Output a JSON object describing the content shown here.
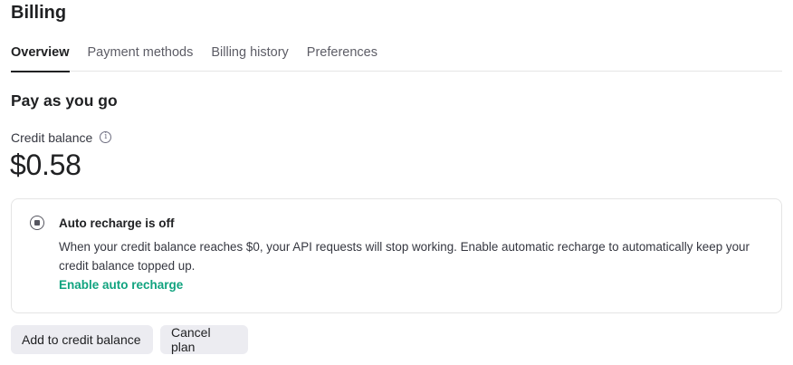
{
  "page": {
    "title": "Billing"
  },
  "tabs": [
    {
      "label": "Overview",
      "active": true
    },
    {
      "label": "Payment methods",
      "active": false
    },
    {
      "label": "Billing history",
      "active": false
    },
    {
      "label": "Preferences",
      "active": false
    }
  ],
  "plan": {
    "title": "Pay as you go",
    "credit_label": "Credit balance",
    "credit_info_icon": "info-icon",
    "balance": "$0.58"
  },
  "auto_recharge": {
    "status_icon": "stop-circle-icon",
    "title": "Auto recharge is off",
    "description": "When your credit balance reaches $0, your API requests will stop working. Enable automatic recharge to automatically keep your credit balance topped up.",
    "link_label": "Enable auto recharge",
    "link_color": "#10a37f"
  },
  "actions": {
    "add_credit_label": "Add to credit balance",
    "cancel_plan_label": "Cancel plan"
  }
}
